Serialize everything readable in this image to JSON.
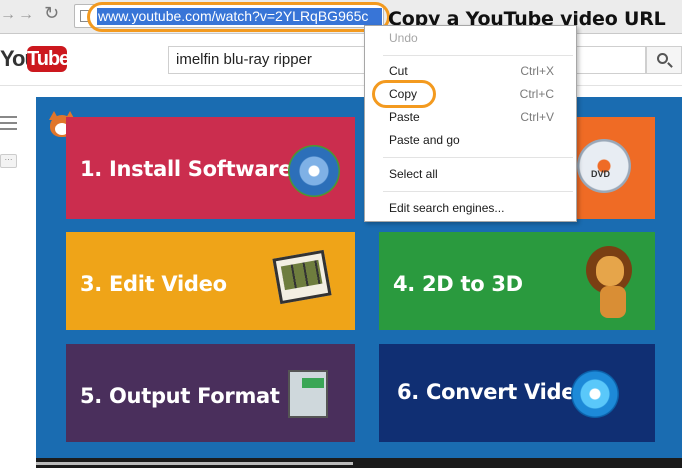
{
  "browser": {
    "url": "www.youtube.com/watch?v=2YLRqBG965c"
  },
  "annotation": {
    "caption": "Copy a YouTube video URL"
  },
  "youtube": {
    "logo_you": "You",
    "logo_tube": "Tube",
    "search_value": "imelfin blu-ray ripper",
    "more_label": "···"
  },
  "video": {
    "tiles": [
      {
        "label": "1. Install Software"
      },
      {
        "label": ""
      },
      {
        "label": "3. Edit Video"
      },
      {
        "label": "4. 2D to 3D"
      },
      {
        "label": "5. Output Format"
      },
      {
        "label": "6. Convert Video"
      }
    ],
    "dvd_text": "DVD",
    "progress_fraction": 0.49
  },
  "context_menu": {
    "undo": "Undo",
    "cut": "Cut",
    "cut_shortcut": "Ctrl+X",
    "copy": "Copy",
    "copy_shortcut": "Ctrl+C",
    "paste": "Paste",
    "paste_shortcut": "Ctrl+V",
    "paste_and_go": "Paste and go",
    "select_all": "Select all",
    "edit_search_engines": "Edit search engines..."
  },
  "colors": {
    "highlight_ring": "#f39a1f",
    "url_selection": "#3875d7",
    "video_bg": "#1a6cb1"
  }
}
